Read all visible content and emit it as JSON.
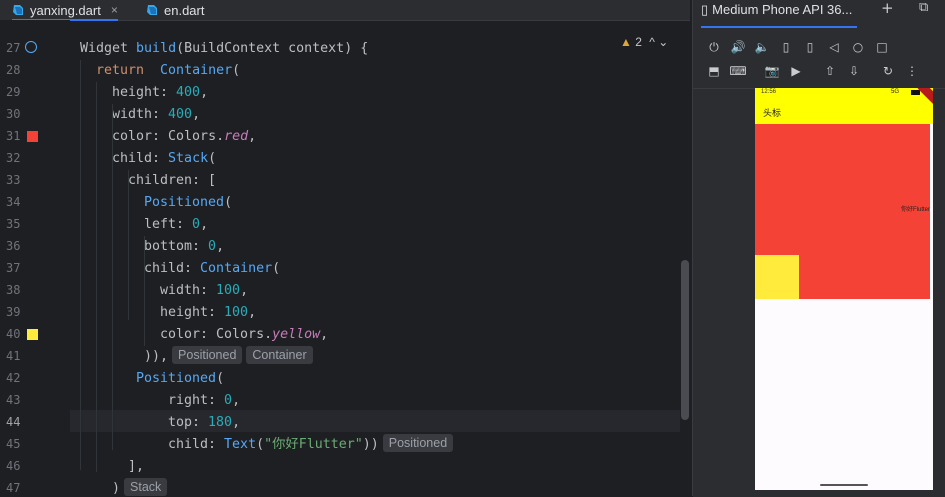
{
  "tabs": [
    {
      "label": "yanxing.dart",
      "close": "×",
      "active": true
    },
    {
      "label": "en.dart",
      "close": "",
      "active": false
    }
  ],
  "warnings": {
    "count": "2",
    "arrows": "^  ⌄"
  },
  "lines": [
    {
      "num": "27",
      "indent": 0,
      "segments": [
        [
          "",
          "Widget "
        ],
        [
          "fn",
          "build"
        ],
        [
          "",
          "(BuildContext context) {"
        ]
      ]
    },
    {
      "num": "28",
      "indent": 1,
      "segments": [
        [
          "kw",
          "return  "
        ],
        [
          "fn",
          "Container"
        ],
        [
          "",
          "("
        ]
      ]
    },
    {
      "num": "29",
      "indent": 2,
      "segments": [
        [
          "",
          "height: "
        ],
        [
          "num",
          "400"
        ],
        [
          "",
          ","
        ]
      ]
    },
    {
      "num": "30",
      "indent": 2,
      "segments": [
        [
          "",
          "width: "
        ],
        [
          "num",
          "400"
        ],
        [
          "",
          ","
        ]
      ]
    },
    {
      "num": "31",
      "indent": 2,
      "segments": [
        [
          "",
          "color: Colors."
        ],
        [
          "it",
          "red"
        ],
        [
          "",
          ","
        ]
      ]
    },
    {
      "num": "32",
      "indent": 2,
      "segments": [
        [
          "",
          "child: "
        ],
        [
          "fn",
          "Stack"
        ],
        [
          "",
          "("
        ]
      ]
    },
    {
      "num": "33",
      "indent": 3,
      "segments": [
        [
          "",
          "children: ["
        ]
      ]
    },
    {
      "num": "34",
      "indent": 4,
      "segments": [
        [
          "fn",
          "Positioned"
        ],
        [
          "",
          "("
        ]
      ]
    },
    {
      "num": "35",
      "indent": 4,
      "segments": [
        [
          "",
          "left: "
        ],
        [
          "num",
          "0"
        ],
        [
          "",
          ","
        ]
      ]
    },
    {
      "num": "36",
      "indent": 4,
      "segments": [
        [
          "",
          "bottom: "
        ],
        [
          "num",
          "0"
        ],
        [
          "",
          ","
        ]
      ]
    },
    {
      "num": "37",
      "indent": 4,
      "segments": [
        [
          "",
          "child: "
        ],
        [
          "fn",
          "Container"
        ],
        [
          "",
          "("
        ]
      ]
    },
    {
      "num": "38",
      "indent": 5,
      "segments": [
        [
          "",
          "width: "
        ],
        [
          "num",
          "100"
        ],
        [
          "",
          ","
        ]
      ]
    },
    {
      "num": "39",
      "indent": 5,
      "segments": [
        [
          "",
          "height: "
        ],
        [
          "num",
          "100"
        ],
        [
          "",
          ","
        ]
      ]
    },
    {
      "num": "40",
      "indent": 5,
      "segments": [
        [
          "",
          "color: Colors."
        ],
        [
          "it",
          "yellow"
        ],
        [
          "",
          ","
        ]
      ]
    },
    {
      "num": "41",
      "indent": 4,
      "segments": [
        [
          "",
          ")),"
        ]
      ],
      "hints": [
        "Positioned",
        "Container"
      ]
    },
    {
      "num": "42",
      "indent": 3.5,
      "segments": [
        [
          "fn",
          "Positioned"
        ],
        [
          "",
          "("
        ]
      ]
    },
    {
      "num": "43",
      "indent": 5.5,
      "segments": [
        [
          "",
          "right: "
        ],
        [
          "num",
          "0"
        ],
        [
          "",
          ","
        ]
      ]
    },
    {
      "num": "44",
      "indent": 5.5,
      "segments": [
        [
          "",
          "top: "
        ],
        [
          "num",
          "180"
        ],
        [
          "",
          ","
        ]
      ]
    },
    {
      "num": "45",
      "indent": 5.5,
      "segments": [
        [
          "",
          "child: "
        ],
        [
          "fn",
          "Text"
        ],
        [
          "",
          "("
        ],
        [
          "str",
          "\"你好Flutter\""
        ],
        [
          "",
          "))"
        ]
      ],
      "hints": [
        "Positioned"
      ]
    },
    {
      "num": "46",
      "indent": 3,
      "segments": [
        [
          "",
          "],"
        ]
      ]
    },
    {
      "num": "47",
      "indent": 2,
      "segments": [
        [
          "",
          ")"
        ]
      ],
      "hints": [
        "Stack"
      ]
    }
  ],
  "current_line": "44",
  "emulator": {
    "title": "Medium Phone API 36...",
    "plus": "+",
    "external": "⧉",
    "toolbar_row1": [
      "⏻",
      "🔊",
      "🔈",
      "▯",
      "▯",
      "◁",
      "○",
      "□"
    ],
    "toolbar_row2": [
      "⬒",
      "⌨",
      "📷",
      "▶",
      "⇧",
      "⇩",
      "↻",
      "⋮"
    ]
  },
  "phone": {
    "time": "12:56",
    "signal": "5G",
    "title": "头标",
    "red_text": "你好Flutter",
    "colors": {
      "appbar": "#ffff00",
      "red": "#f44336",
      "yellow": "#ffeb3b"
    }
  }
}
